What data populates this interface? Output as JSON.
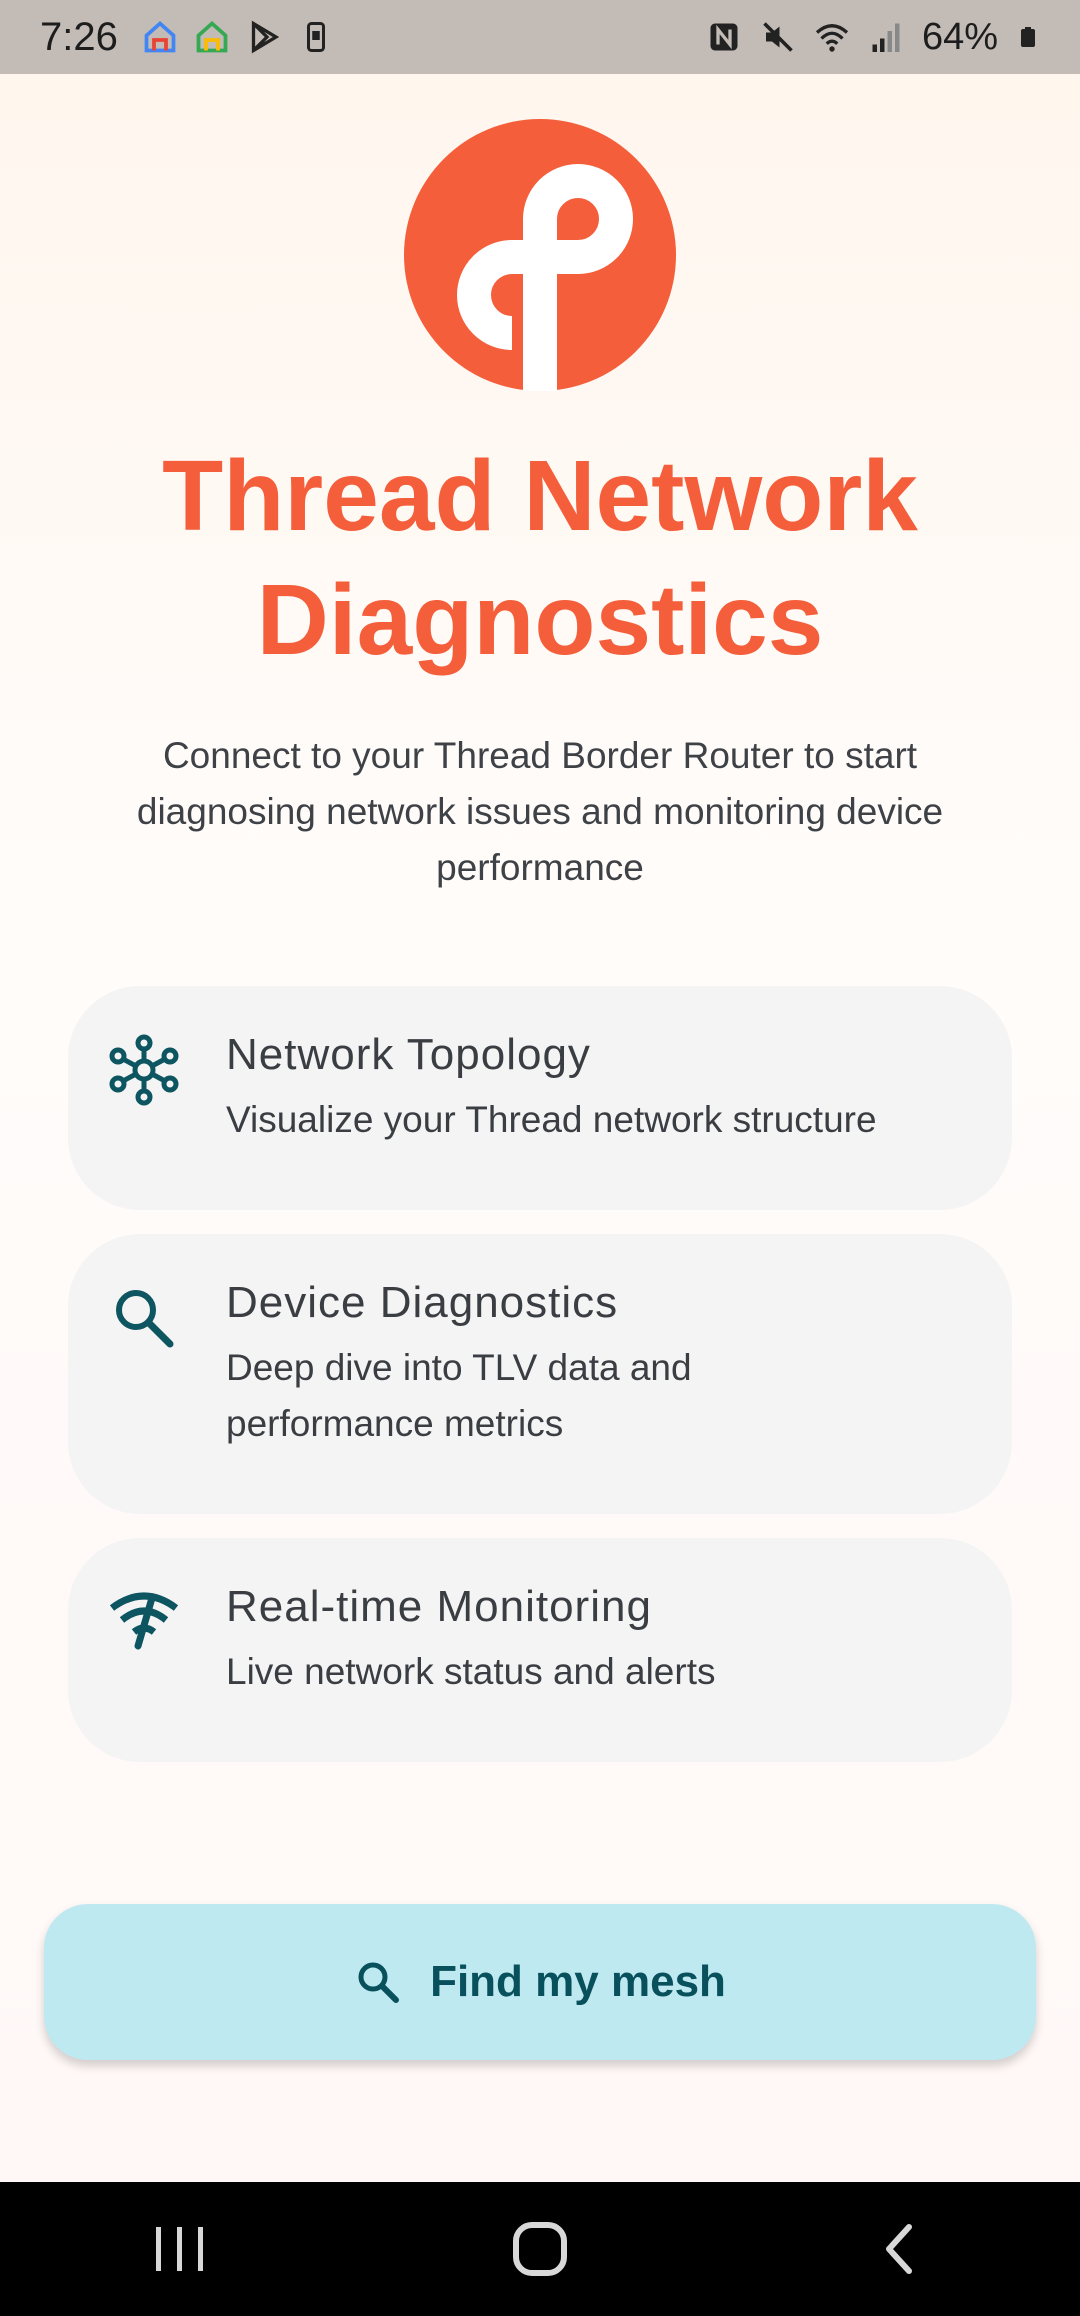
{
  "status_bar": {
    "time": "7:26",
    "battery": "64%"
  },
  "app": {
    "title_line1": "Thread Network",
    "title_line2": "Diagnostics",
    "subtitle": "Connect to your Thread Border Router to start diagnosing network issues and monitoring device performance",
    "accent_color": "#f45e3a",
    "icon_color": "#0d5560"
  },
  "features": [
    {
      "icon": "network-topology-icon",
      "title": "Network Topology",
      "description": "Visualize your Thread network structure"
    },
    {
      "icon": "search-icon",
      "title": "Device Diagnostics",
      "description": "Deep dive into TLV data and performance metrics"
    },
    {
      "icon": "wifi-monitoring-icon",
      "title": "Real-time Monitoring",
      "description": "Live network status and alerts"
    }
  ],
  "button": {
    "label": "Find my mesh",
    "icon": "search-icon"
  },
  "nav": {
    "recent": "recent-apps-icon",
    "home": "home-icon",
    "back": "back-icon"
  }
}
